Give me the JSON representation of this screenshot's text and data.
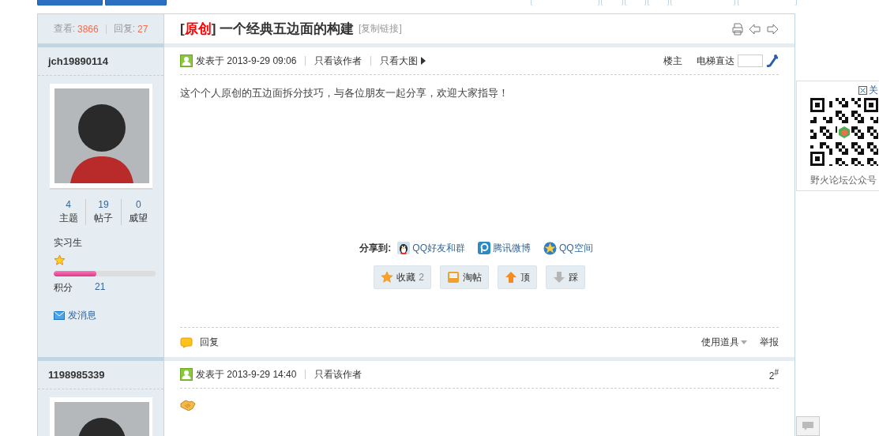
{
  "thread": {
    "views_label": "查看:",
    "views": "3866",
    "replies_label": "回复:",
    "replies": "27",
    "prefix_open": "[",
    "prefix": "原创",
    "prefix_close": "]",
    "title": "一个经典五边面的构建",
    "copy_link": "[复制链接]"
  },
  "posts": [
    {
      "author": "jch19890114",
      "stats": [
        {
          "value": "4",
          "label": "主题"
        },
        {
          "value": "19",
          "label": "帖子"
        },
        {
          "value": "0",
          "label": "威望"
        }
      ],
      "rank": "实习生",
      "level": 0.42,
      "points_label": "积分",
      "points": "21",
      "message": "发消息",
      "posted": "发表于 2013-9-29 09:06",
      "links": [
        "只看该作者",
        "只看大图"
      ],
      "has_more_arrow": true,
      "floor": "楼主",
      "jump_label": "电梯直达",
      "body": {
        "kind": "text",
        "text": "这个个人原创的五边面拆分技巧，与各位朋友一起分享，欢迎大家指导！"
      },
      "share_label": "分享到:",
      "share": [
        {
          "kind": "qq",
          "label": "QQ好友和群"
        },
        {
          "kind": "weibo",
          "label": "腾讯微博"
        },
        {
          "kind": "qzone",
          "label": "QQ空间"
        }
      ],
      "actions": [
        {
          "kind": "star",
          "label": "收藏",
          "count": "2"
        },
        {
          "kind": "tray",
          "label": "淘帖"
        },
        {
          "kind": "up",
          "label": "顶"
        },
        {
          "kind": "down",
          "label": "踩"
        }
      ],
      "reply": "回复",
      "tools": "使用道具",
      "report": "举报"
    },
    {
      "author": "1198985339",
      "posted": "发表于 2013-9-29 14:40",
      "links": [
        "只看该作者"
      ],
      "has_more_arrow": false,
      "floor": "2$^{#}$",
      "body": {
        "kind": "emoji"
      }
    }
  ],
  "qr": {
    "close": "关",
    "caption": "野火论坛公众号"
  }
}
